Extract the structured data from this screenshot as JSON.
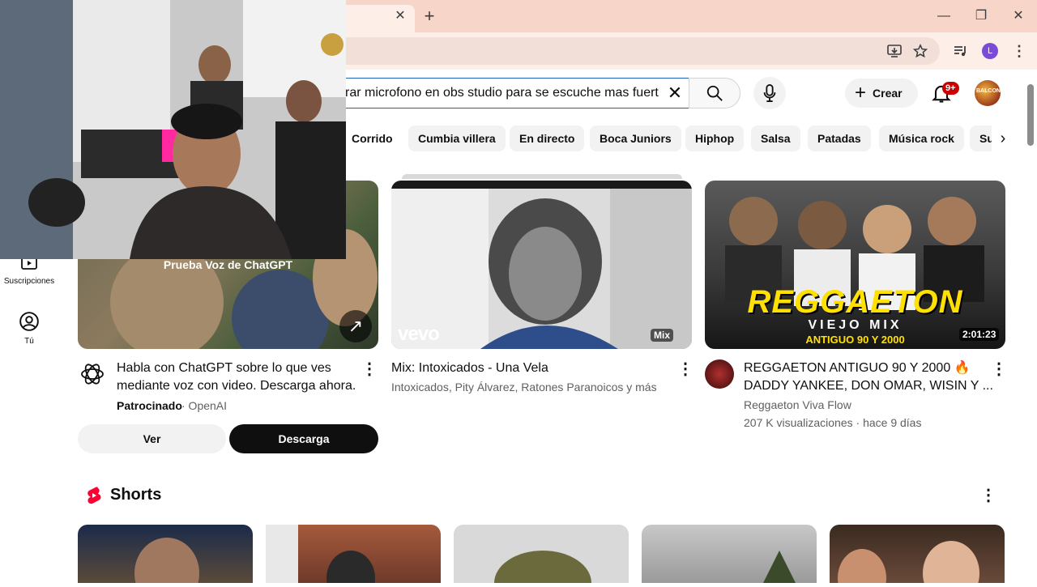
{
  "browser": {
    "tab_close": "✕",
    "new_tab": "+",
    "window_minimize": "—",
    "window_restore": "❐",
    "window_close": "✕",
    "profile_letter": "L"
  },
  "search": {
    "query": "rar microfono en obs studio para se escuche mas fuert"
  },
  "header": {
    "create_label": "Crear",
    "notifications_badge": "9+",
    "avatar_text": "BALCON"
  },
  "chips": [
    "Corrido",
    "Cumbia villera",
    "En directo",
    "Boca Juniors",
    "Hiphop",
    "Salsa",
    "Patadas",
    "Música rock",
    "Su"
  ],
  "sidebar": {
    "items": [
      {
        "label": "Suscripciones",
        "icon": "subscriptions-icon"
      },
      {
        "label": "Tú",
        "icon": "you-icon"
      }
    ]
  },
  "cards": [
    {
      "thumb_caption": "Prueba Voz de ChatGPT",
      "title_line1": "Habla con ChatGPT sobre lo que ves",
      "title_line2": "mediante voz con video. Descarga ahora.",
      "sponsored": "Patrocinado",
      "advertiser": "· OpenAI",
      "btn_view": "Ver",
      "btn_download": "Descarga"
    },
    {
      "thumb_brand": "vevo",
      "thumb_badge": "Mix",
      "title": "Mix: Intoxicados - Una Vela",
      "meta": "Intoxicados, Pity Álvarez, Ratones Paranoicos y más"
    },
    {
      "thumb_title": "REGGAETON",
      "thumb_sub1": "VIEJO MIX",
      "thumb_sub2": "ANTIGUO 90 Y 2000",
      "duration": "2:01:23",
      "title_line1": "REGGAETON ANTIGUO 90 Y 2000 🔥",
      "title_line2": "DADDY YANKEE, DON OMAR, WISIN Y ...",
      "channel": "Reggaeton Viva Flow",
      "stats": "207 K visualizaciones · hace 9 días"
    }
  ],
  "shorts": {
    "title": "Shorts",
    "count": 5
  },
  "colors": {
    "tabstrip": "#f8d5c9",
    "toolbar": "#fdeee8",
    "accent_red": "#ff0000",
    "download_button": "#0f0f0f"
  }
}
